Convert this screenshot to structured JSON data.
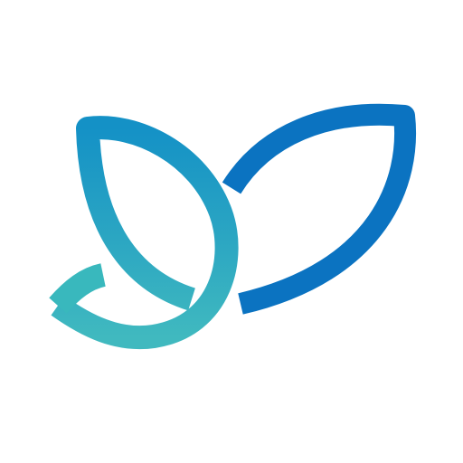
{
  "logo": {
    "icon_name": "two-leaf-sprout-icon",
    "background_color": "#ffffff",
    "colors": {
      "right_leaf": "#0b73c1",
      "left_leaf_top": "#1491c6",
      "left_leaf_bottom": "#40b9bf",
      "tail": "#39b8bd"
    }
  }
}
